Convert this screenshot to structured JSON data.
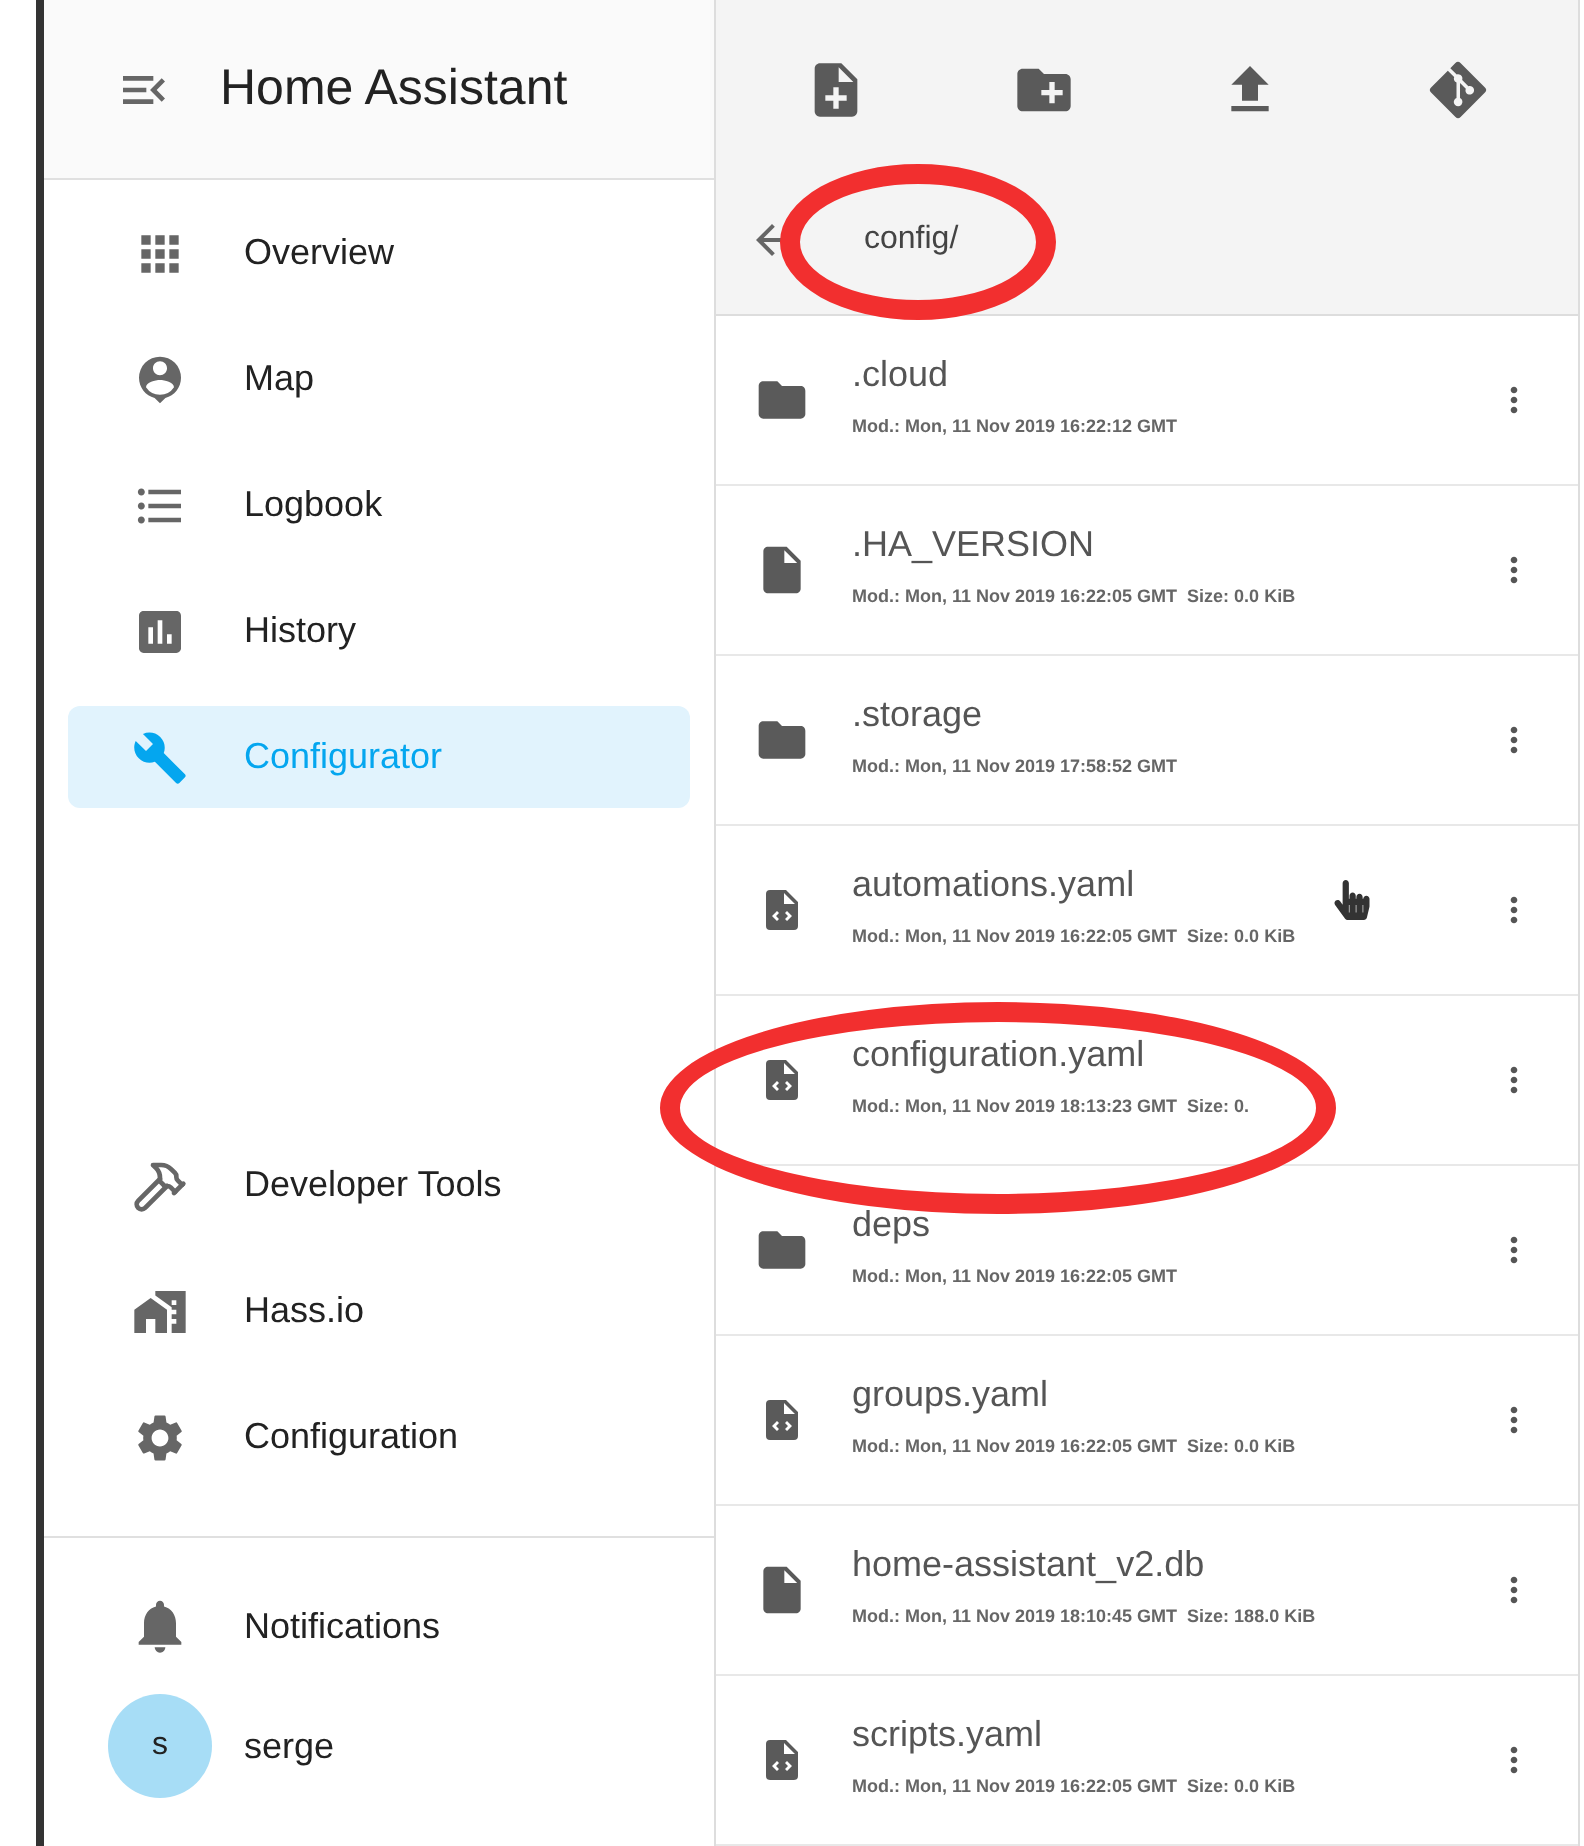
{
  "sidebar": {
    "title": "Home Assistant",
    "items": [
      {
        "label": "Overview",
        "selected": false
      },
      {
        "label": "Map",
        "selected": false
      },
      {
        "label": "Logbook",
        "selected": false
      },
      {
        "label": "History",
        "selected": false
      },
      {
        "label": "Configurator",
        "selected": true
      }
    ],
    "tools": [
      {
        "label": "Developer Tools",
        "selected": false
      },
      {
        "label": "Hass.io",
        "selected": false
      },
      {
        "label": "Configuration",
        "selected": false
      }
    ],
    "notifications": {
      "label": "Notifications"
    },
    "user": {
      "initial": "s",
      "name": "serge"
    }
  },
  "browser": {
    "path": "config/",
    "path_circled": true,
    "files": [
      {
        "kind": "folder",
        "name": ".cloud",
        "modified": "Mod.: Mon, 11 Nov 2019 16:22:12 GMT",
        "circled": false
      },
      {
        "kind": "file",
        "name": ".HA_VERSION",
        "modified": "Mod.: Mon, 11 Nov 2019 16:22:05 GMT",
        "size": "Size: 0.0 KiB",
        "circled": false
      },
      {
        "kind": "folder",
        "name": ".storage",
        "modified": "Mod.: Mon, 11 Nov 2019 17:58:52 GMT",
        "circled": false
      },
      {
        "kind": "code",
        "name": "automations.yaml",
        "modified": "Mod.: Mon, 11 Nov 2019 16:22:05 GMT",
        "size": "Size: 0.0 KiB",
        "circled": false
      },
      {
        "kind": "code",
        "name": "configuration.yaml",
        "modified": "Mod.: Mon, 11 Nov 2019 18:13:23 GMT",
        "size": "Size: 0.",
        "circled": true
      },
      {
        "kind": "folder",
        "name": "deps",
        "modified": "Mod.: Mon, 11 Nov 2019 16:22:05 GMT",
        "circled": false
      },
      {
        "kind": "code",
        "name": "groups.yaml",
        "modified": "Mod.: Mon, 11 Nov 2019 16:22:05 GMT",
        "size": "Size: 0.0 KiB",
        "circled": false
      },
      {
        "kind": "file",
        "name": "home-assistant_v2.db",
        "modified": "Mod.: Mon, 11 Nov 2019 18:10:45 GMT",
        "size": "Size: 188.0 KiB",
        "circled": false
      },
      {
        "kind": "code",
        "name": "scripts.yaml",
        "modified": "Mod.: Mon, 11 Nov 2019 16:22:05 GMT",
        "size": "Size: 0.0 KiB",
        "circled": false
      }
    ]
  }
}
